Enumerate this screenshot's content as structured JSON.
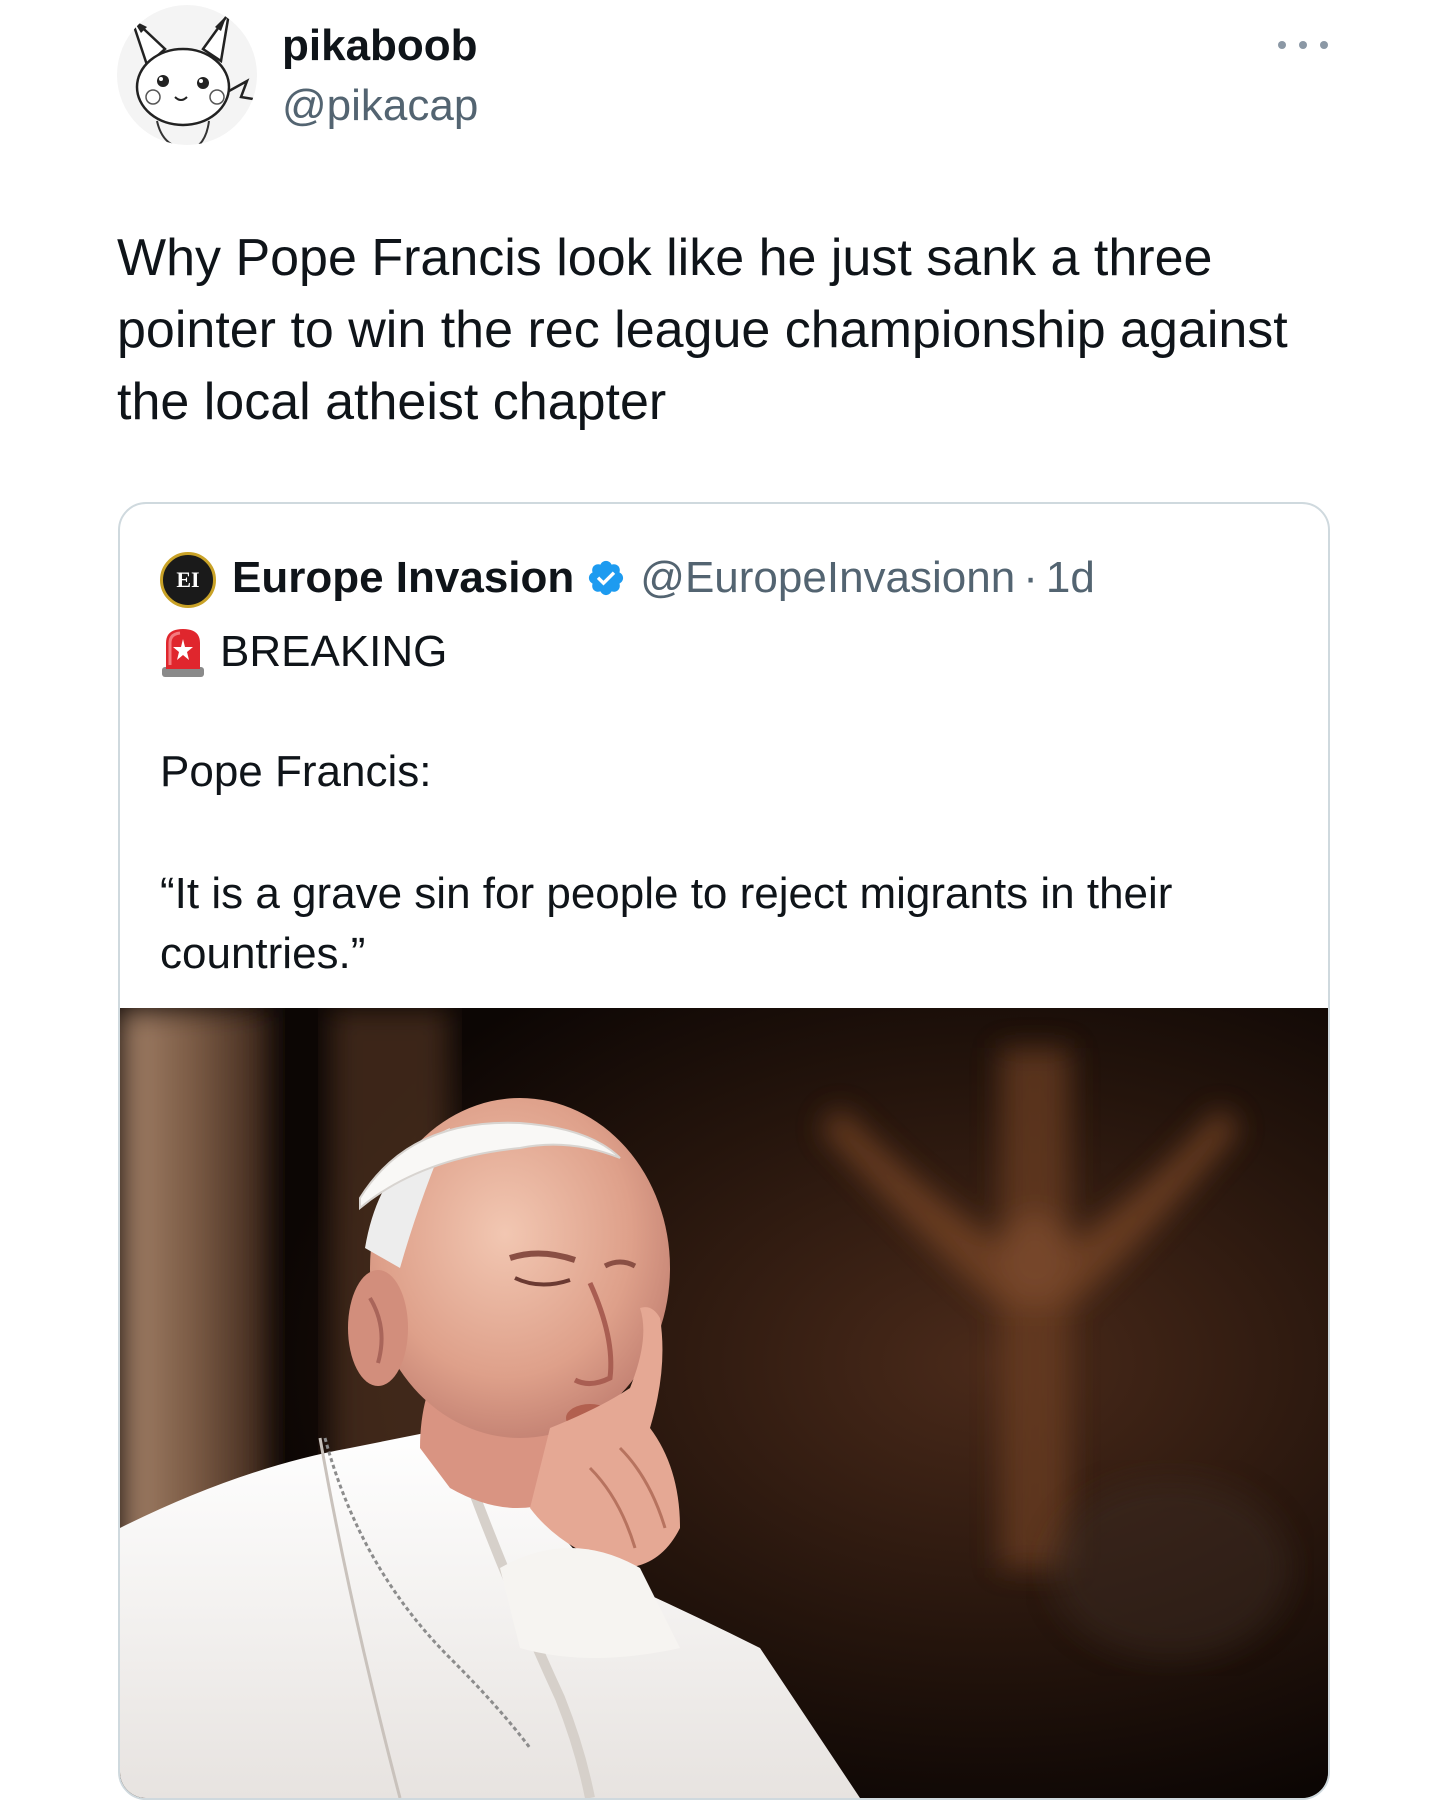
{
  "tweet": {
    "author": {
      "name": "pikaboob",
      "handle": "@pikacap",
      "avatar_icon": "pikachu-sketch-avatar"
    },
    "more_icon": "ellipsis-icon",
    "text": "Why Pope Francis look like he just sank a three pointer to win the rec league championship against the local atheist chapter"
  },
  "quoted_tweet": {
    "author": {
      "name": "Europe Invasion",
      "handle": "@EuropeInvasionn",
      "verified": true,
      "avatar_text": "EI",
      "avatar_icon": "europe-invasion-logo"
    },
    "separator": "·",
    "time": "1d",
    "badge_icon": "police-light-emoji",
    "breaking": "BREAKING",
    "lines": [
      "Pope Francis:",
      "“It is a grave sin for people to reject migrants in their countries.”"
    ],
    "media": {
      "icon": "photo-pope-francis"
    }
  },
  "colors": {
    "text_primary": "#0f1419",
    "text_secondary": "#536471",
    "border": "#cfd9de",
    "verified_blue": "#1d9bf0"
  }
}
